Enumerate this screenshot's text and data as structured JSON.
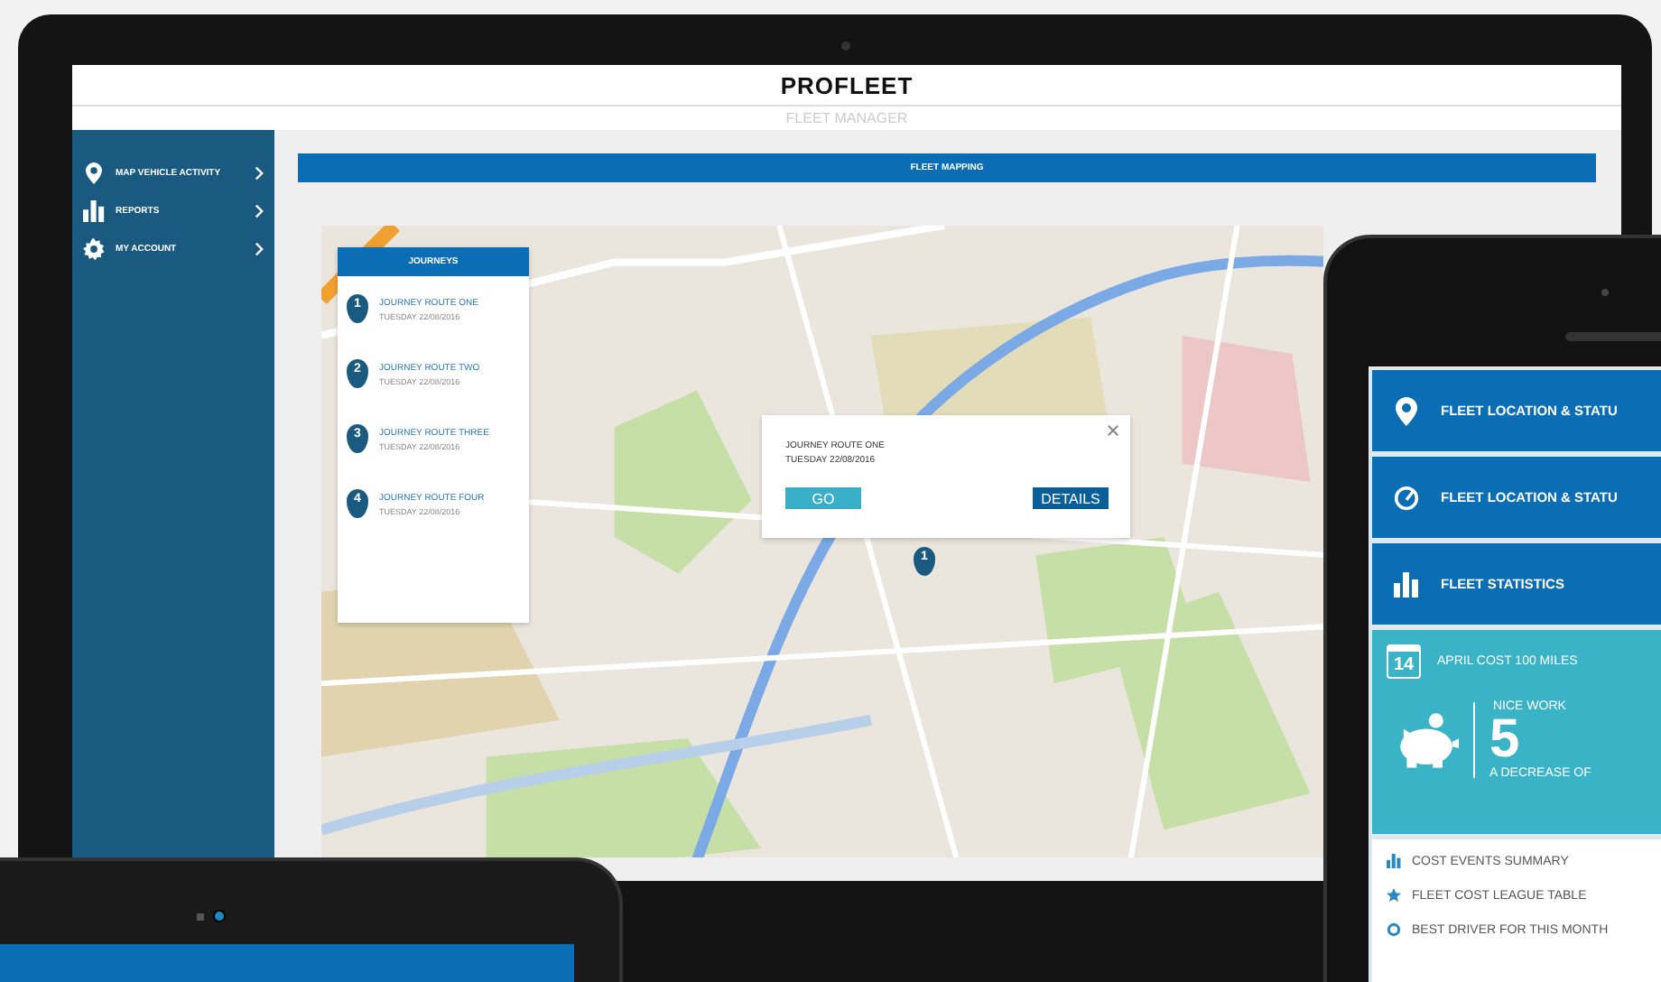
{
  "laptop": {
    "logo": "PROFLEET",
    "subtitle": "FLEET MANAGER",
    "sidebar": {
      "items": [
        {
          "kind": "pin",
          "label": "MAP VEHICLE ACTIVITY"
        },
        {
          "kind": "bars",
          "label": "REPORTS"
        },
        {
          "kind": "gear",
          "label": "MY ACCOUNT"
        }
      ]
    },
    "title_bar": "FLEET MAPPING",
    "journeys": {
      "title": "JOURNEYS",
      "items": [
        {
          "number": "1",
          "name": "JOURNEY ROUTE ONE",
          "date": "TUESDAY 22/08/2016"
        },
        {
          "number": "2",
          "name": "JOURNEY ROUTE TWO",
          "date": "TUESDAY 22/08/2016"
        },
        {
          "number": "3",
          "name": "JOURNEY ROUTE THREE",
          "date": "TUESDAY 22/08/2016"
        },
        {
          "number": "4",
          "name": "JOURNEY ROUTE FOUR",
          "date": "TUESDAY 22/08/2016"
        }
      ]
    },
    "popup": {
      "title": "JOURNEY ROUTE ONE",
      "date": "TUESDAY 22/08/2016",
      "buttons": [
        {
          "label": "GO",
          "kind": "secondary"
        },
        {
          "label": "DETAILS",
          "kind": "primary"
        }
      ]
    },
    "map_marker": "1"
  },
  "phone": {
    "menu": [
      {
        "kind": "pin",
        "label": "FLEET LOCATION & STATU"
      },
      {
        "kind": "gauge",
        "label": "FLEET LOCATION & STATU"
      },
      {
        "kind": "bars",
        "label": "FLEET STATISTICS"
      }
    ],
    "card": {
      "calendar_day": "14",
      "title": "APRIL COST 100 MILES",
      "headline": "NICE WORK",
      "figure": "5",
      "note": "A DECREASE OF"
    },
    "links": [
      {
        "kind": "bars",
        "label": "COST EVENTS SUMMARY"
      },
      {
        "kind": "star",
        "label": "FLEET COST LEAGUE TABLE"
      },
      {
        "kind": "ring",
        "label": "BEST DRIVER FOR THIS MONTH"
      }
    ]
  }
}
